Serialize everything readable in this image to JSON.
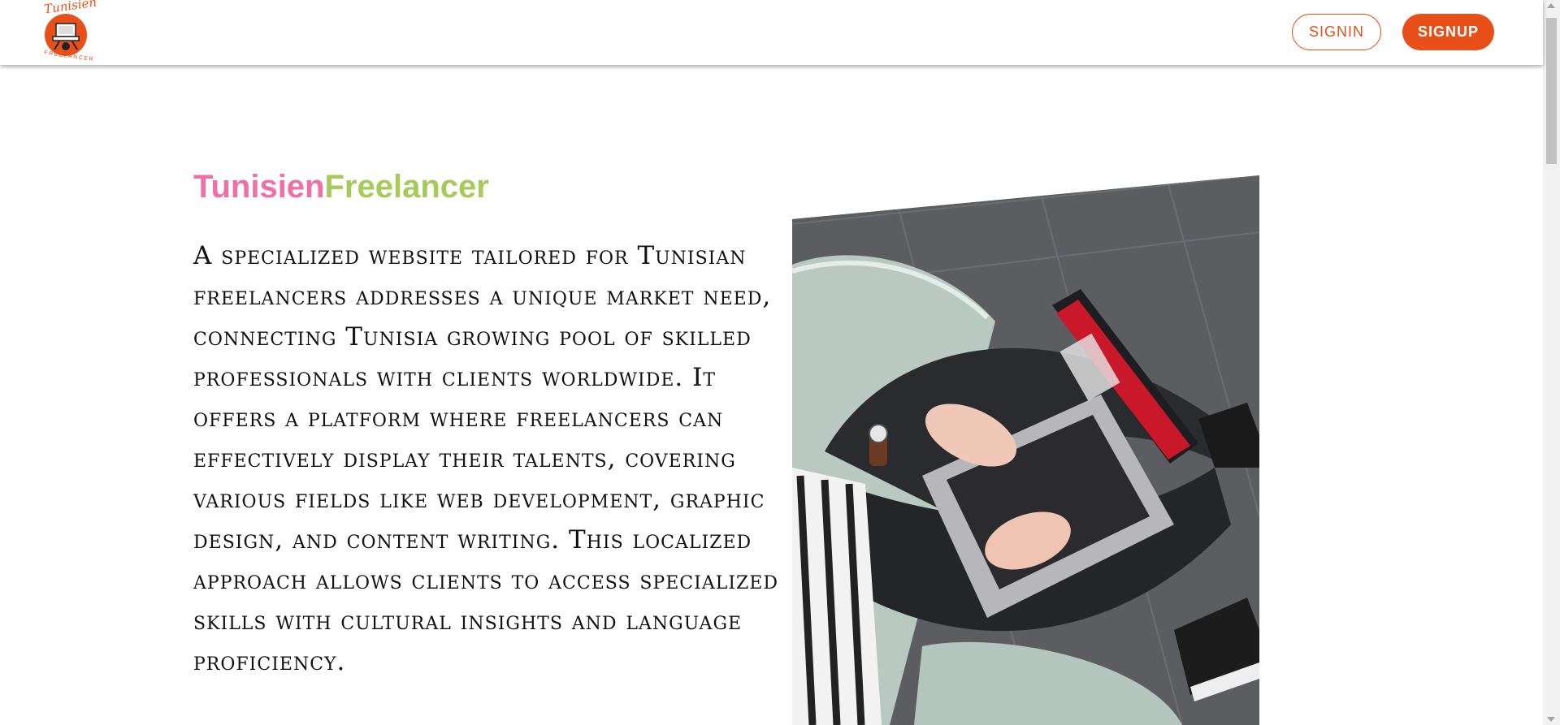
{
  "header": {
    "logo": {
      "top_text": "Tunisien",
      "bottom_text": "FREELANCER"
    },
    "signin_label": "SIGNIN",
    "signup_label": "SIGNUP"
  },
  "hero": {
    "brand_part1": "Tunisien",
    "brand_part2": "Freelancer",
    "description": "A specialized website tailored for Tunisian freelancers addresses a unique market need, connecting Tunisia growing pool of skilled professionals with clients worldwide. It offers a platform where freelancers can effectively display their talents, covering various fields like web development, graphic design, and content writing. This localized approach allows clients to access specialized skills with cultural insights and language proficiency."
  },
  "colors": {
    "accent": "#e8501a",
    "brand_part1": "#ef6fa6",
    "brand_part2": "#a7cb5a"
  }
}
